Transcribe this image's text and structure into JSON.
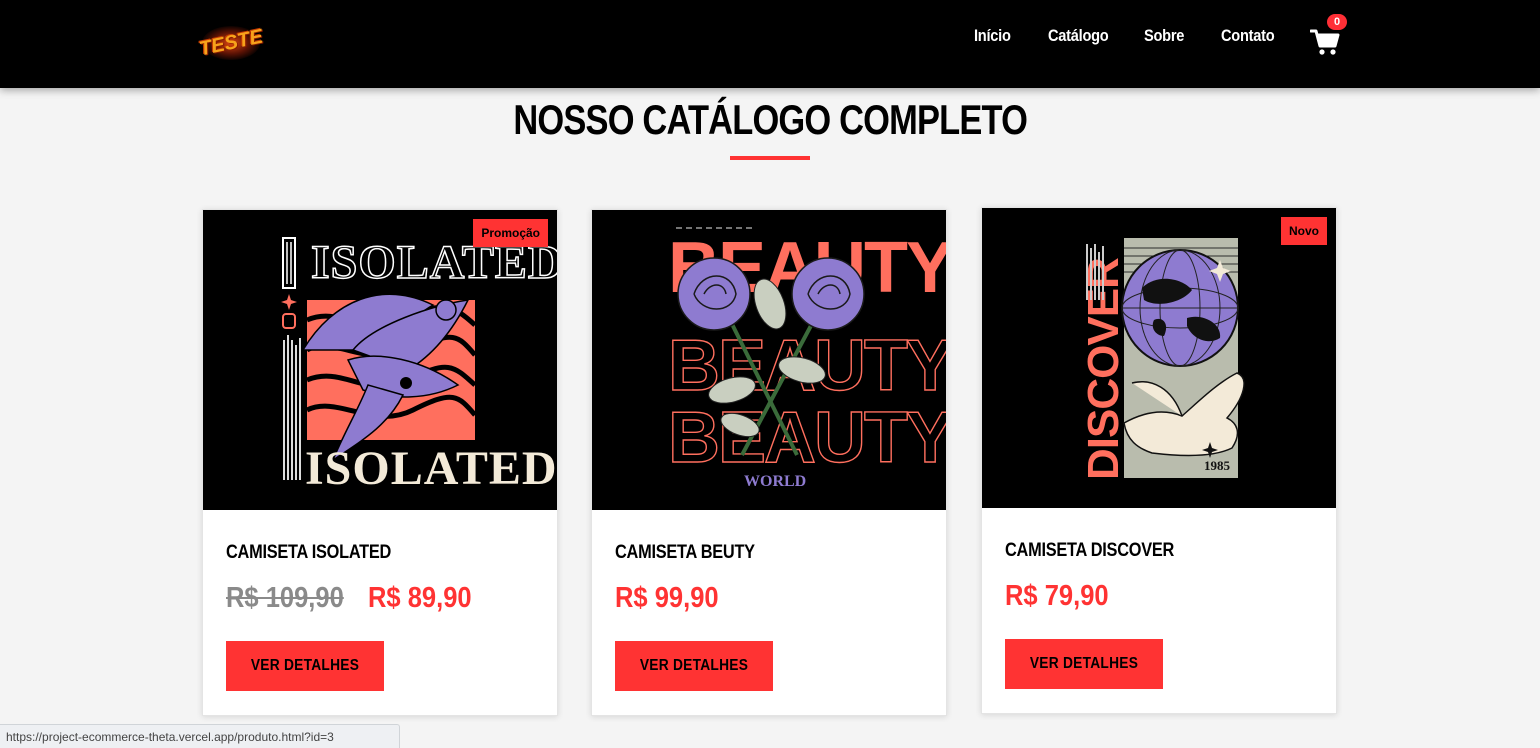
{
  "header": {
    "logo_text": "TESTE",
    "nav": [
      "Início",
      "Catálogo",
      "Sobre",
      "Contato"
    ],
    "cart_count": "0"
  },
  "catalog": {
    "title": "NOSSO CATÁLOGO COMPLETO",
    "products": [
      {
        "name": "CAMISETA ISOLATED",
        "badge": "Promoção",
        "old_price": "R$ 109,90",
        "price": "R$ 89,90",
        "button": "VER DETALHES",
        "art": {
          "top_word": "ISOLATED",
          "bottom_word": "ISOLATED"
        }
      },
      {
        "name": "CAMISETA BEUTY",
        "badge": "",
        "old_price": "",
        "price": "R$ 99,90",
        "button": "VER DETALHES",
        "art": {
          "word": "BEAUTY",
          "sub_word": "WORLD"
        }
      },
      {
        "name": "CAMISETA DISCOVER",
        "badge": "Novo",
        "old_price": "",
        "price": "R$ 79,90",
        "button": "VER DETALHES",
        "art": {
          "word": "DISCOVER",
          "year": "1985"
        }
      }
    ]
  },
  "status_bar": {
    "url": "https://project-ecommerce-theta.vercel.app/produto.html?id=3"
  },
  "colors": {
    "accent": "#ff3333",
    "header_bg": "#000000",
    "page_bg": "#f4f4f4",
    "art_coral": "#ff6f5e",
    "art_purple": "#8e7bd0",
    "art_cream": "#f3ead8"
  }
}
